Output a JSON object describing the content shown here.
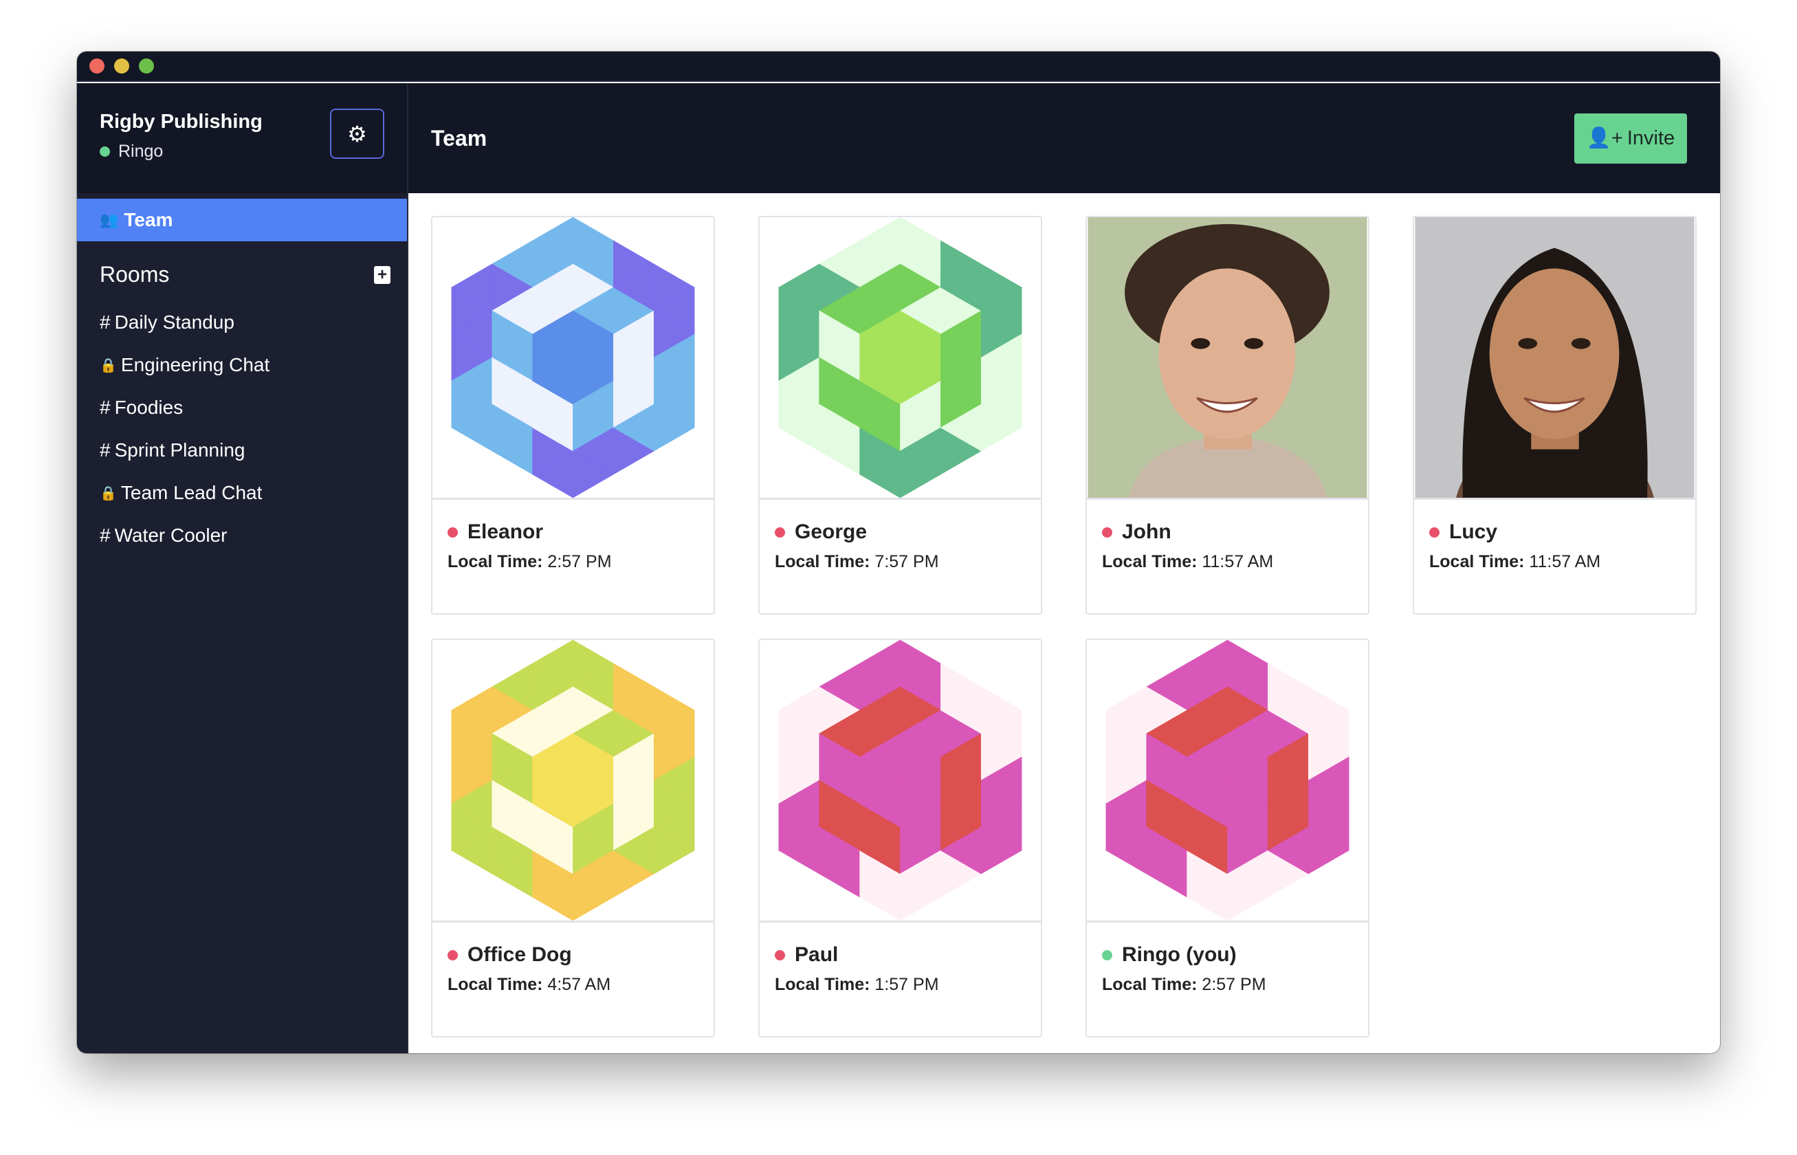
{
  "window": {
    "controls": {
      "close": "#ee6a5e",
      "minimize": "#e2c044",
      "zoom": "#6cc04a"
    }
  },
  "sidebar": {
    "workspace": "Rigby Publishing",
    "user": "Ringo",
    "user_status_color": "#68d391",
    "settings_icon": "gear-icon",
    "team_label": "Team",
    "team_icon": "users-icon",
    "rooms_label": "Rooms",
    "add_room_icon": "plus-square-icon",
    "rooms": [
      {
        "prefix": "#",
        "label": "Daily Standup"
      },
      {
        "prefix": "🔒",
        "label": "Engineering Chat"
      },
      {
        "prefix": "#",
        "label": "Foodies"
      },
      {
        "prefix": "#",
        "label": "Sprint Planning"
      },
      {
        "prefix": "🔒",
        "label": "Team Lead Chat"
      },
      {
        "prefix": "#",
        "label": "Water Cooler"
      }
    ]
  },
  "header": {
    "title": "Team",
    "invite_label": "Invite",
    "invite_icon": "user-plus-icon",
    "accent": "#68d391"
  },
  "time_label": "Local Time:",
  "members": [
    {
      "name": "Eleanor",
      "time": "2:57 PM",
      "status": "offline",
      "avatar": "identicon",
      "colors": [
        "#5b8ee8",
        "#eef2fd",
        "#74b8ec",
        "#7b6fea"
      ]
    },
    {
      "name": "George",
      "time": "7:57 PM",
      "status": "offline",
      "avatar": "identicon",
      "colors": [
        "#a6e35a",
        "#76d05a",
        "#e3fbe0",
        "#5fb98a"
      ]
    },
    {
      "name": "John",
      "time": "11:57 AM",
      "status": "offline",
      "avatar": "photo"
    },
    {
      "name": "Lucy",
      "time": "11:57 AM",
      "status": "offline",
      "avatar": "photo"
    },
    {
      "name": "Office Dog",
      "time": "4:57 AM",
      "status": "offline",
      "avatar": "identicon",
      "colors": [
        "#f5e05a",
        "#fffbe0",
        "#c5dc55",
        "#f7c955"
      ]
    },
    {
      "name": "Paul",
      "time": "1:57 PM",
      "status": "offline",
      "avatar": "identicon",
      "colors": [
        "#d957b8",
        "#dc5050",
        "#d957b8",
        "#fff0f6"
      ]
    },
    {
      "name": "Ringo (you)",
      "time": "2:57 PM",
      "status": "online",
      "avatar": "identicon",
      "colors": [
        "#d957b8",
        "#dc5050",
        "#d957b8",
        "#fff0f6"
      ]
    }
  ],
  "status_colors": {
    "online": "#68d391",
    "offline": "#e8506a"
  }
}
